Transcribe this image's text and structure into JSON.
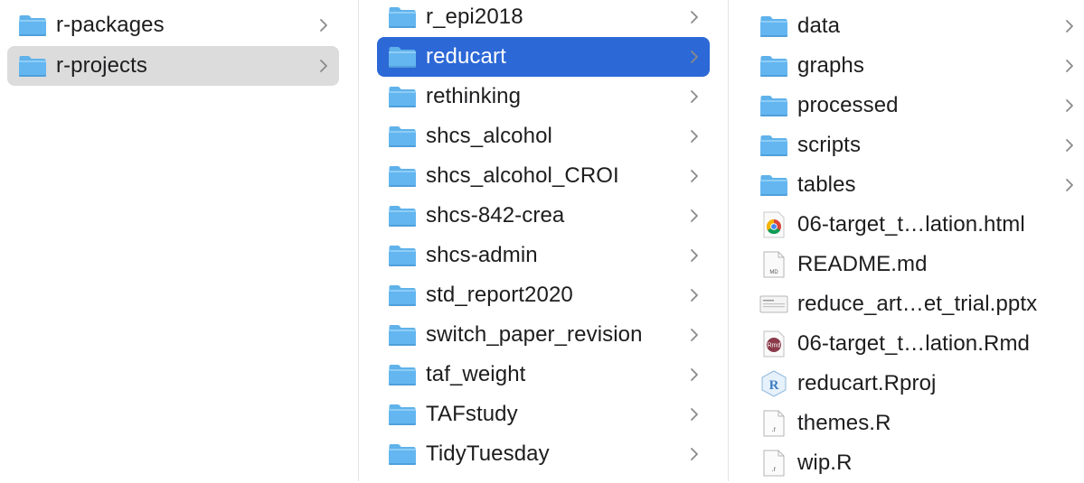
{
  "colors": {
    "selection_blue": "#2c68d6",
    "selection_grey": "#dcdcdc",
    "folder_blue": "#5ab0ec"
  },
  "column1": {
    "items": [
      {
        "label": "r-packages",
        "icon": "folder-icon"
      },
      {
        "label": "r-projects",
        "icon": "folder-icon"
      }
    ]
  },
  "column2": {
    "items": [
      {
        "label": "r_epi2018"
      },
      {
        "label": "reducart"
      },
      {
        "label": "rethinking"
      },
      {
        "label": "shcs_alcohol"
      },
      {
        "label": "shcs_alcohol_CROI"
      },
      {
        "label": "shcs-842-crea"
      },
      {
        "label": "shcs-admin"
      },
      {
        "label": "std_report2020"
      },
      {
        "label": "switch_paper_revision"
      },
      {
        "label": "taf_weight"
      },
      {
        "label": "TAFstudy"
      },
      {
        "label": "TidyTuesday"
      }
    ]
  },
  "column3": {
    "items": [
      {
        "label": "data",
        "icon": "folder-icon"
      },
      {
        "label": "graphs",
        "icon": "folder-icon"
      },
      {
        "label": "processed",
        "icon": "folder-icon"
      },
      {
        "label": "scripts",
        "icon": "folder-icon"
      },
      {
        "label": "tables",
        "icon": "folder-icon"
      },
      {
        "label": "06-target_t…lation.html",
        "icon": "chrome-html-file-icon"
      },
      {
        "label": "README.md",
        "icon": "markdown-file-icon",
        "icon_text": "MD"
      },
      {
        "label": "reduce_art…et_trial.pptx",
        "icon": "pptx-file-icon"
      },
      {
        "label": "06-target_t…lation.Rmd",
        "icon": "rmd-file-icon",
        "icon_text": "Rmd"
      },
      {
        "label": "reducart.Rproj",
        "icon": "rproj-file-icon",
        "icon_text": "R"
      },
      {
        "label": "themes.R",
        "icon": "r-script-file-icon",
        "icon_text": ".r"
      },
      {
        "label": "wip.R",
        "icon": "r-script-file-icon",
        "icon_text": ".r"
      }
    ]
  }
}
